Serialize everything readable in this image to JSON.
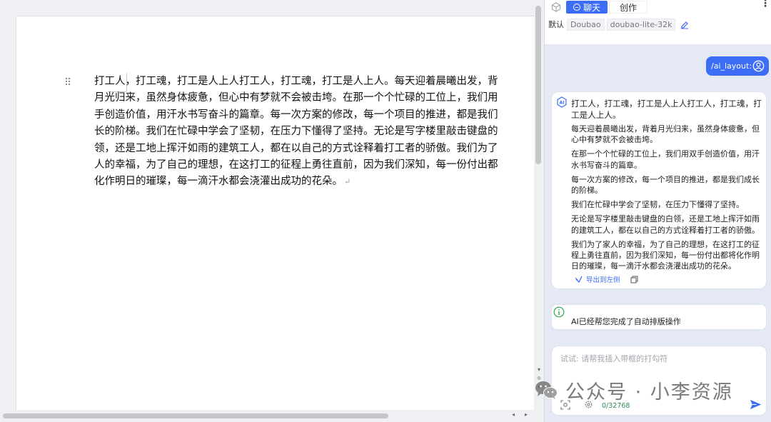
{
  "document": {
    "lines": [
      "打工人，打工魂，打工是人上人打工人，打工魂，打工是人上人。每天迎着晨曦出发，背",
      "月光归来，虽然身体疲惫，但心中有梦就不会被击垮。在那一个个忙碌的工位上，我们用",
      "手创造价值，用汗水书写奋斗的篇章。每一次方案的修改，每一个项目的推进，都是我们",
      "长的阶梯。我们在忙碌中学会了坚韧，在压力下懂得了坚持。无论是写字楼里敲击键盘的",
      "领，还是工地上挥汗如雨的建筑工人，都在以自己的方式诠释着打工者的骄傲。我们为了",
      "人的幸福，为了自己的理想，在这打工的征程上勇往直前，因为我们深知，每一份付出都",
      "化作明日的璀璨，每一滴汗水都会浇灌出成功的花朵。"
    ],
    "paragraph_mark": "↵",
    "drag_handle": "⠿"
  },
  "scrollbar": {
    "v_arrows": "▾\n≑\n▾",
    "h_left": "◂",
    "h_right": "▸"
  },
  "panel": {
    "tabs": {
      "chat": "聊天",
      "create": "创作"
    },
    "more": "⋮",
    "model_label": "默认",
    "model_chips": [
      "Doubao",
      "doubao-lite-32k"
    ],
    "user_message": "/ai_layout:",
    "answer": {
      "paragraphs": [
        "打工人，打工魂，打工是人上人打工人，打工魂，打工是人上人。",
        "每天迎着晨曦出发，背着月光归来，虽然身体疲惫，但心中有梦就不会被击垮。",
        "在那一个个忙碌的工位上，我们用双手创造价值，用汗水书写奋斗的篇章。",
        "每一次方案的修改，每一个项目的推进，都是我们成长的阶梯。",
        "我们在忙碌中学会了坚韧，在压力下懂得了坚持。",
        "无论是写字楼里敲击键盘的白领，还是工地上挥汗如雨的建筑工人，都在以自己的方式诠释着打工者的骄傲。",
        "我们为了家人的幸福，为了自己的理想，在这打工的征程上勇往直前，因为我们深知，每一份付出都将化作明日的璀璨，每一滴汗水都会浇灌出成功的花朵。"
      ],
      "export_label": "导出到左侧"
    },
    "notice": "AI已经帮您完成了自动排版操作",
    "input": {
      "placeholder": "试试: 请帮我插入带框的打勾符",
      "char_count": "0/32768"
    }
  },
  "watermark": "公众号 · 小李资源",
  "colors": {
    "accent": "#3d6df6",
    "panel_bg": "#e5e9f3",
    "count_green": "#2e8b57"
  },
  "icons": [
    "cube-icon",
    "chat-icon",
    "edit-icon",
    "user-avatar-icon",
    "ai-logo-icon",
    "export-icon",
    "copy-icon",
    "info-icon",
    "scan-icon",
    "settings-icon",
    "send-icon",
    "wechat-icon"
  ]
}
